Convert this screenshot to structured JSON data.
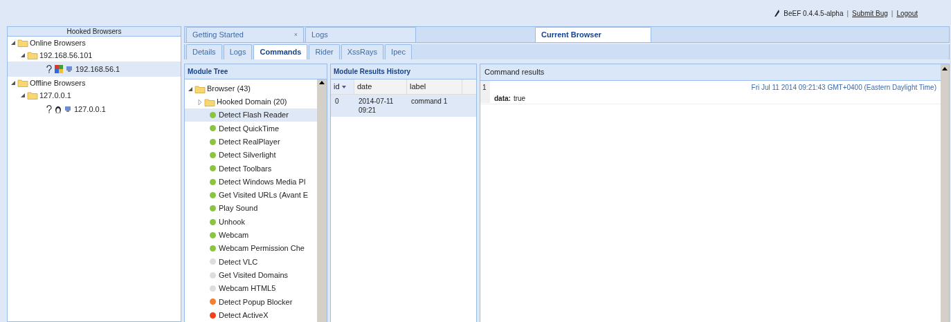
{
  "header": {
    "version": "BeEF 0.4.4.5-alpha",
    "separator": "|",
    "links": [
      "Submit Bug",
      "Logout"
    ]
  },
  "hooked_browsers": {
    "title": "Hooked Browsers",
    "groups": [
      {
        "label": "Online Browsers",
        "expanded": true,
        "children": [
          {
            "label": "192.168.56.101",
            "expanded": true,
            "children": [
              {
                "label": "192.168.56.1",
                "kind": "windows",
                "selected": true
              }
            ]
          }
        ]
      },
      {
        "label": "Offline Browsers",
        "expanded": true,
        "children": [
          {
            "label": "127.0.0.1",
            "expanded": true,
            "children": [
              {
                "label": "127.0.0.1",
                "kind": "linux",
                "selected": false
              }
            ]
          }
        ]
      }
    ]
  },
  "main_tabs": [
    {
      "label": "Getting Started",
      "close_label": "×",
      "selected": false
    },
    {
      "label": "Logs",
      "selected": false
    },
    {
      "label": "Current Browser",
      "selected": true
    }
  ],
  "browser_tabs": [
    {
      "label": "Details",
      "selected": false
    },
    {
      "label": "Logs",
      "selected": false
    },
    {
      "label": "Commands",
      "selected": true
    },
    {
      "label": "Rider",
      "selected": false
    },
    {
      "label": "XssRays",
      "selected": false
    },
    {
      "label": "Ipec",
      "selected": false
    }
  ],
  "module_tree": {
    "title": "Module Tree",
    "root": {
      "label": "Browser (43)",
      "expanded": true,
      "children": [
        {
          "label": "Hooked Domain (20)",
          "expanded": false
        }
      ]
    },
    "modules": [
      {
        "label": "Detect Flash Reader",
        "color": "#8bc53f",
        "selected": true
      },
      {
        "label": "Detect QuickTime",
        "color": "#8bc53f",
        "selected": false
      },
      {
        "label": "Detect RealPlayer",
        "color": "#8bc53f",
        "selected": false
      },
      {
        "label": "Detect Silverlight",
        "color": "#8bc53f",
        "selected": false
      },
      {
        "label": "Detect Toolbars",
        "color": "#8bc53f",
        "selected": false
      },
      {
        "label": "Detect Windows Media Pl",
        "color": "#8bc53f",
        "selected": false
      },
      {
        "label": "Get Visited URLs (Avant E",
        "color": "#8bc53f",
        "selected": false
      },
      {
        "label": "Play Sound",
        "color": "#8bc53f",
        "selected": false
      },
      {
        "label": "Unhook",
        "color": "#8bc53f",
        "selected": false
      },
      {
        "label": "Webcam",
        "color": "#8bc53f",
        "selected": false
      },
      {
        "label": "Webcam Permission Che",
        "color": "#8bc53f",
        "selected": false
      },
      {
        "label": "Detect VLC",
        "color": "#dddddd",
        "selected": false
      },
      {
        "label": "Get Visited Domains",
        "color": "#dddddd",
        "selected": false
      },
      {
        "label": "Webcam HTML5",
        "color": "#dddddd",
        "selected": false
      },
      {
        "label": "Detect Popup Blocker",
        "color": "#f57f2a",
        "selected": false
      },
      {
        "label": "Detect ActiveX",
        "color": "#f2401a",
        "selected": false
      }
    ]
  },
  "history": {
    "title": "Module Results History",
    "columns": [
      "id",
      "date",
      "label"
    ],
    "rows": [
      {
        "id": "0",
        "date": "2014-07-11 09:21",
        "label": "command 1",
        "selected": true
      }
    ]
  },
  "command_results": {
    "title": "Command results",
    "entries": [
      {
        "index": "1",
        "timestamp": "Fri Jul 11 2014 09:21:43 GMT+0400 (Eastern Daylight Time)",
        "key": "data:",
        "value": "true"
      }
    ]
  }
}
